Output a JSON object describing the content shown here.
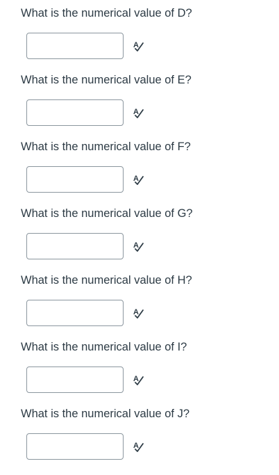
{
  "questions": [
    {
      "text": "What is the numerical value of D?",
      "value": "",
      "icon": "spell-check-icon"
    },
    {
      "text": "What is the numerical value of E?",
      "value": "",
      "icon": "spell-check-icon"
    },
    {
      "text": "What is the numerical value of F?",
      "value": "",
      "icon": "spell-check-icon"
    },
    {
      "text": "What is the numerical value of G?",
      "value": "",
      "icon": "spell-check-icon"
    },
    {
      "text": "What is the numerical value of H?",
      "value": "",
      "icon": "spell-check-icon"
    },
    {
      "text": "What is the numerical value of I?",
      "value": "",
      "icon": "spell-check-icon"
    },
    {
      "text": "What is the numerical value of J?",
      "value": "",
      "icon": "spell-check-icon"
    }
  ],
  "colors": {
    "text": "#2d3b45",
    "input_border": "#8b969e",
    "icon": "#2d3b45"
  }
}
